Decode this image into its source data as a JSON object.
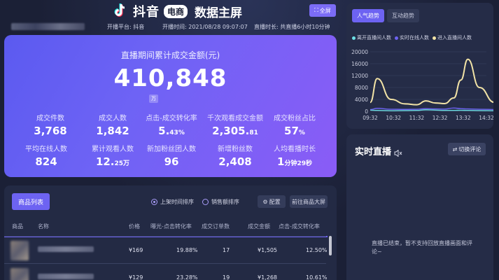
{
  "header": {
    "brand": "抖音",
    "brand_badge": "电商",
    "title": "数据主屏",
    "fullscreen_label": "全屏",
    "platform": "开播平台: 抖音",
    "start_time": "开播时间: 2021/08/28 09:07:07",
    "duration": "直播时长: 共直播6小时10分钟"
  },
  "stats": {
    "main_label": "直播期间累计成交金额(元)",
    "main_value": "410,848",
    "main_unit": "万",
    "metrics": [
      {
        "label": "成交件数",
        "value": "3,768",
        "unit": ""
      },
      {
        "label": "成交人数",
        "value": "1,842",
        "unit": ""
      },
      {
        "label": "点击-成交转化率",
        "value": "5.",
        "unit": "43%"
      },
      {
        "label": "千次观看成交金额",
        "value": "2,305.",
        "unit": "81"
      },
      {
        "label": "成交粉丝占比",
        "value": "57",
        "unit": "%"
      },
      {
        "label": "平均在线人数",
        "value": "824",
        "unit": ""
      },
      {
        "label": "累计观看人数",
        "value": "12.",
        "unit": "25万"
      },
      {
        "label": "新加粉丝团人数",
        "value": "96",
        "unit": ""
      },
      {
        "label": "新增粉丝数",
        "value": "2,408",
        "unit": ""
      },
      {
        "label": "人均看播时长",
        "value": "1",
        "unit": "分钟29秒"
      }
    ]
  },
  "products": {
    "tab_label": "商品列表",
    "sort_time": "上架时间排序",
    "sort_sales": "销售额排序",
    "config_label": "配置",
    "goto_label": "前往商品大屏",
    "columns": [
      "商品",
      "名称",
      "价格",
      "曝光-点击转化率",
      "成交订单数",
      "成交金额",
      "点击-成交转化率"
    ],
    "rows": [
      {
        "price": "¥169",
        "exposure_click": "19.88%",
        "orders": "17",
        "amount": "¥1,505",
        "click_deal": "12.50%"
      },
      {
        "price": "¥129",
        "exposure_click": "23.28%",
        "orders": "19",
        "amount": "¥1,268",
        "click_deal": "10.61%"
      }
    ]
  },
  "trend": {
    "tab_popularity": "人气趋势",
    "tab_interaction": "互动趋势",
    "colors": {
      "leave": "#6de0e6",
      "online": "#6d63f2",
      "enter": "#f2e3a6"
    }
  },
  "chart_data": {
    "type": "line",
    "x": [
      "09:32",
      "10:32",
      "11:32",
      "12:32",
      "13:32",
      "14:32"
    ],
    "ylim": [
      0,
      20000
    ],
    "yticks": [
      0,
      4000,
      8000,
      12000,
      16000,
      20000
    ],
    "legend_position": "top",
    "series": [
      {
        "name": "离开直播间人数",
        "values": [
          400,
          300,
          200,
          250,
          300,
          500,
          400,
          300,
          300,
          350,
          300,
          250,
          200
        ]
      },
      {
        "name": "实时在线人数",
        "values": [
          600,
          1000,
          700,
          650,
          700,
          900,
          800,
          750,
          1100,
          900,
          800,
          700,
          600
        ]
      },
      {
        "name": "进入直播间人数",
        "values": [
          3000,
          11000,
          4000,
          2500,
          2200,
          3500,
          2800,
          2600,
          4500,
          10500,
          17500,
          8000,
          3000
        ]
      }
    ],
    "series_x": [
      0,
      0.3,
      0.9,
      1.5,
      2.0,
      2.4,
      2.8,
      3.2,
      3.6,
      3.9,
      4.2,
      4.7,
      5.35
    ]
  },
  "live": {
    "title": "实时直播",
    "switch_label": "切换评论",
    "ended_text": "直播已结束，暂不支持回放直播画面和评论~"
  }
}
